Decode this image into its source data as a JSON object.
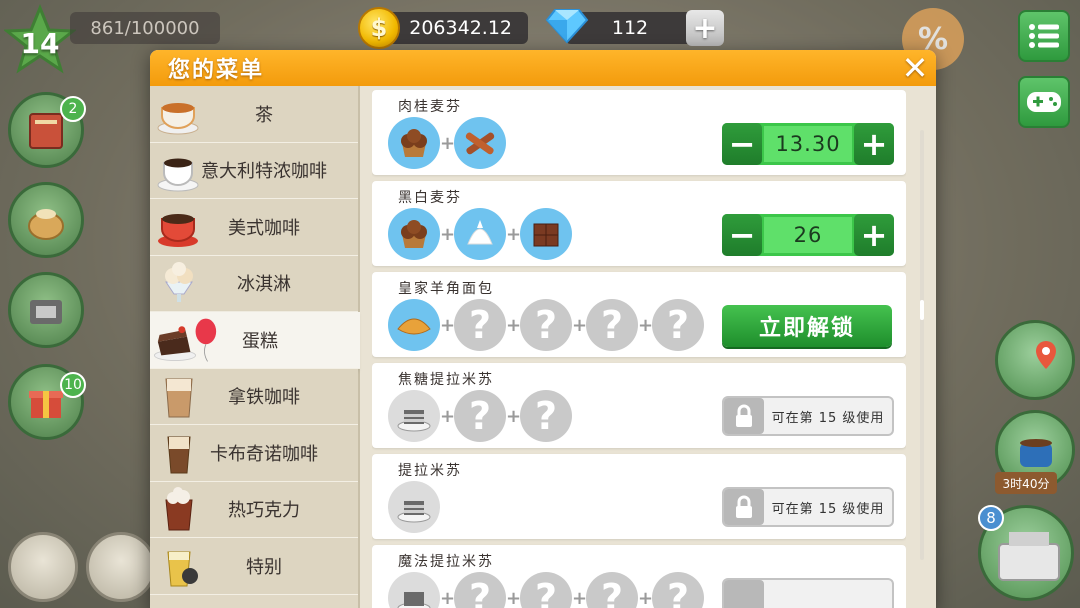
{
  "hud": {
    "level": "14",
    "xp": "861/100000",
    "coins": "206342.12",
    "coin_symbol": "$",
    "gems": "112",
    "gem_plus": "+",
    "sale_symbol": "%",
    "journal_badge": "2",
    "gift_badge": "10",
    "timer": "3时40分",
    "register_badge": "8"
  },
  "dialog": {
    "title": "您的菜单",
    "close_symbol": "✕"
  },
  "categories": [
    {
      "label": "茶",
      "icon": "tea-cup-icon",
      "active": false
    },
    {
      "label": "意大利特浓咖啡",
      "icon": "espresso-cup-icon",
      "active": false
    },
    {
      "label": "美式咖啡",
      "icon": "americano-cup-icon",
      "active": false
    },
    {
      "label": "冰淇淋",
      "icon": "ice-cream-icon",
      "active": false
    },
    {
      "label": "蛋糕",
      "icon": "cake-icon",
      "active": true
    },
    {
      "label": "拿铁咖啡",
      "icon": "latte-glass-icon",
      "active": false
    },
    {
      "label": "卡布奇诺咖啡",
      "icon": "cappuccino-glass-icon",
      "active": false
    },
    {
      "label": "热巧克力",
      "icon": "hot-chocolate-icon",
      "active": false
    },
    {
      "label": "特别",
      "icon": "special-drink-icon",
      "active": false
    }
  ],
  "recipes": [
    {
      "name": "肉桂麦芬",
      "ingredients": [
        "muffin-icon",
        "cinnamon-icon"
      ],
      "price": "13.30",
      "state": "price"
    },
    {
      "name": "黑白麦芬",
      "ingredients": [
        "muffin-icon",
        "whipped-cream-icon",
        "chocolate-bar-icon"
      ],
      "price": "26",
      "state": "price"
    },
    {
      "name": "皇家羊角面包",
      "ingredients": [
        "croissant-icon",
        "?",
        "?",
        "?",
        "?"
      ],
      "unlock_label": "立即解锁",
      "state": "unlock"
    },
    {
      "name": "焦糖提拉米苏",
      "ingredients": [
        "tiramisu-icon",
        "?",
        "?"
      ],
      "lock_label": "可在第 15 级使用",
      "state": "locked"
    },
    {
      "name": "提拉米苏",
      "ingredients": [
        "tiramisu-icon"
      ],
      "lock_label": "可在第 15 级使用",
      "state": "locked"
    },
    {
      "name": "魔法提拉米苏",
      "ingredients": [
        "tiramisu-icon",
        "?",
        "?",
        "?",
        "?"
      ],
      "state": "locked"
    }
  ],
  "symbols": {
    "plus": "+",
    "minus": "−",
    "question": "?"
  },
  "colors": {
    "header_orange": "#f7a11a",
    "price_green": "#3cc64a",
    "ingredient_blue": "#6fc3ef"
  }
}
